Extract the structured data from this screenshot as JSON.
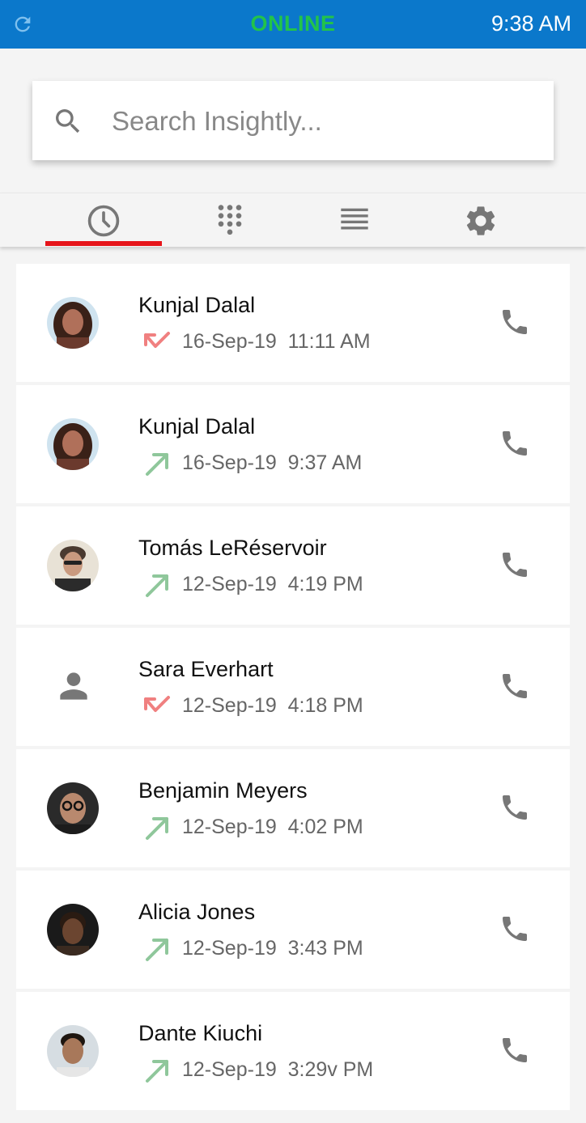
{
  "status_bar": {
    "connection": "ONLINE",
    "time": "9:38 AM",
    "refresh_icon": "refresh-icon"
  },
  "search": {
    "placeholder": "Search Insightly...",
    "value": ""
  },
  "tabs": [
    {
      "icon": "clock-icon",
      "active": true
    },
    {
      "icon": "dialpad-icon",
      "active": false
    },
    {
      "icon": "list-icon",
      "active": false
    },
    {
      "icon": "gear-icon",
      "active": false
    }
  ],
  "colors": {
    "header": "#0b78cb",
    "online": "#22c34a",
    "tab_indicator": "#e6141a",
    "missed": "#f08080",
    "outgoing": "#8fc79b"
  },
  "calls": [
    {
      "name": "Kunjal Dalal",
      "direction": "missed",
      "date": "16-Sep-19",
      "time": "11:11 AM",
      "avatar": "photo"
    },
    {
      "name": "Kunjal Dalal",
      "direction": "outgoing",
      "date": "16-Sep-19",
      "time": "9:37 AM",
      "avatar": "photo"
    },
    {
      "name": "Tomás LeRéservoir",
      "direction": "outgoing",
      "date": "12-Sep-19",
      "time": "4:19 PM",
      "avatar": "photo"
    },
    {
      "name": "Sara Everhart",
      "direction": "missed",
      "date": "12-Sep-19",
      "time": "4:18 PM",
      "avatar": "person-icon"
    },
    {
      "name": "Benjamin Meyers",
      "direction": "outgoing",
      "date": "12-Sep-19",
      "time": "4:02 PM",
      "avatar": "photo"
    },
    {
      "name": "Alicia Jones",
      "direction": "outgoing",
      "date": "12-Sep-19",
      "time": "3:43 PM",
      "avatar": "photo"
    },
    {
      "name": "Dante Kiuchi",
      "direction": "outgoing",
      "date": "12-Sep-19",
      "time": "3:29v PM",
      "avatar": "photo"
    }
  ]
}
